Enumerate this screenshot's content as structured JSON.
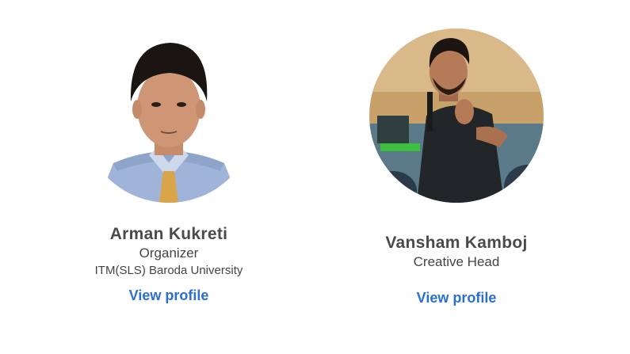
{
  "members": [
    {
      "name": "Arman Kukreti",
      "role": "Organizer",
      "organization": "ITM(SLS) Baroda University",
      "link_label": "View profile"
    },
    {
      "name": "Vansham Kamboj",
      "role": "Creative Head",
      "link_label": "View profile"
    }
  ],
  "colors": {
    "name": "#4a4a4a",
    "text": "#444444",
    "link": "#2a6fd1",
    "background": "#ffffff"
  }
}
